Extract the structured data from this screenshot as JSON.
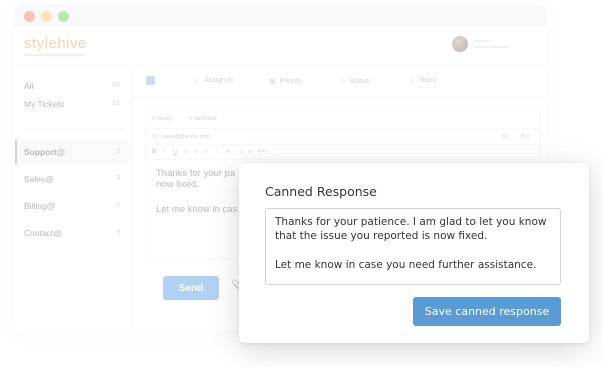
{
  "app": {
    "logo": "stylehive"
  },
  "sidebar": {
    "items": [
      {
        "label": "All",
        "count": "43"
      },
      {
        "label": "My Tickets",
        "count": "12"
      },
      {
        "label": "Support@",
        "count": "3"
      },
      {
        "label": "Sales@",
        "count": "3"
      },
      {
        "label": "Billing@",
        "count": "2"
      },
      {
        "label": "Contact@",
        "count": "3"
      }
    ]
  },
  "toolbar": {
    "assign": "Assign to",
    "priority": "Priority",
    "status": "Status",
    "team": "Team"
  },
  "reply": {
    "tab_reply": "Reply",
    "tab_note": "Add Note",
    "to": "To: support@acme.com",
    "cc": "Cc",
    "bcc": "Bcc",
    "body_line1": "Thanks for your pa",
    "body_line2": "now fixed.",
    "body_line3": "Let me know in cas",
    "send": "Send"
  },
  "modal": {
    "title": "Canned Response",
    "text": "Thanks for your patience. I am glad to let you know that the issue you reported is now fixed.\n\nLet me know in case you need further assistance.",
    "save_label": "Save canned response"
  },
  "colors": {
    "accent": "#5b9bd5",
    "send": "#4a90e2",
    "logo": "#e89a3c"
  }
}
